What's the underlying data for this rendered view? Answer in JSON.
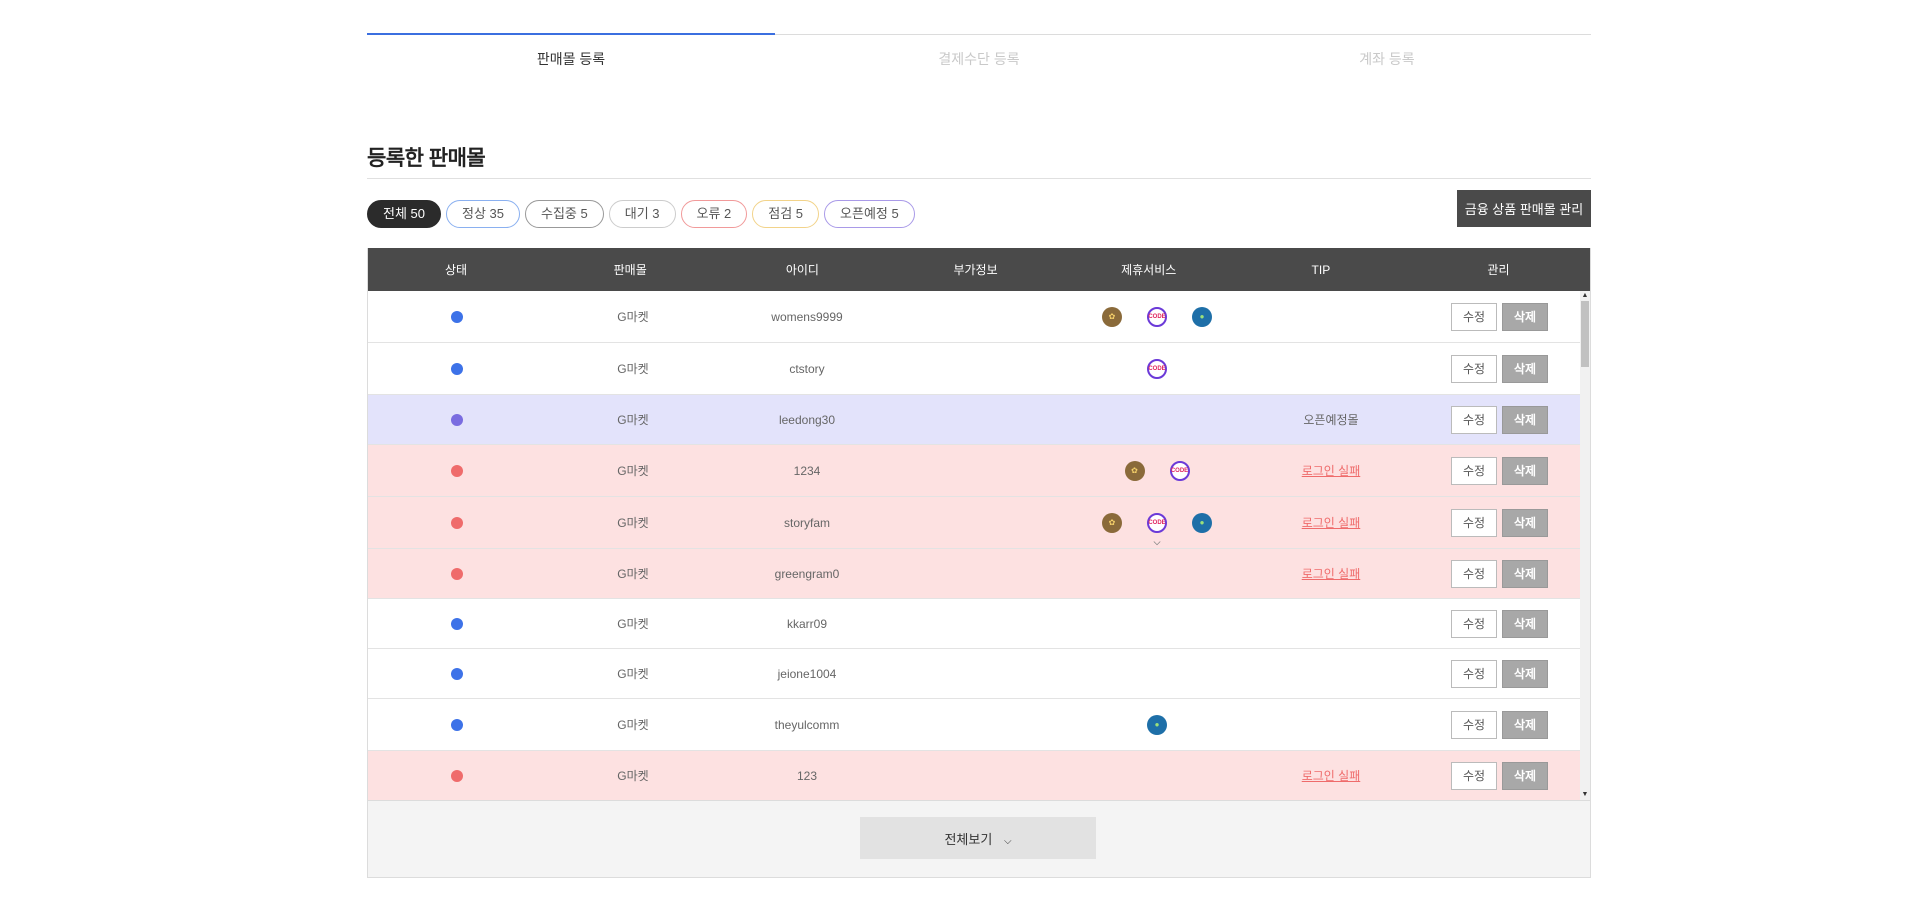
{
  "steps": [
    {
      "label": "판매몰 등록",
      "active": true
    },
    {
      "label": "결제수단 등록",
      "active": false
    },
    {
      "label": "계좌 등록",
      "active": false
    }
  ],
  "section_title": "등록한 판매몰",
  "filters": [
    {
      "label": "전체 50",
      "color": "#2b2b2b",
      "active": true
    },
    {
      "label": "정상 35",
      "color": "#8ab0f0",
      "active": false
    },
    {
      "label": "수집중 5",
      "color": "#999999",
      "active": false
    },
    {
      "label": "대기 3",
      "color": "#cccccc",
      "active": false
    },
    {
      "label": "오류 2",
      "color": "#f19a9a",
      "active": false
    },
    {
      "label": "점검 5",
      "color": "#f2d38a",
      "active": false
    },
    {
      "label": "오픈예정 5",
      "color": "#a99ae8",
      "active": false
    }
  ],
  "manage_button": "금융 상품 판매몰 관리",
  "table": {
    "headers": [
      "상태",
      "판매몰",
      "아이디",
      "부가정보",
      "제휴서비스",
      "TIP",
      "관리"
    ],
    "edit_label": "수정",
    "delete_label": "삭제",
    "rows": [
      {
        "status": "normal",
        "mall": "G마켓",
        "id": "womens9999",
        "extra": "",
        "services": [
          "coin",
          "code",
          "globe"
        ],
        "tip": "",
        "tip_link": false
      },
      {
        "status": "normal",
        "mall": "G마켓",
        "id": "ctstory",
        "extra": "",
        "services": [
          "code"
        ],
        "tip": "",
        "tip_link": false
      },
      {
        "status": "open",
        "mall": "G마켓",
        "id": "leedong30",
        "extra": "",
        "services": [],
        "tip": "오픈예정몰",
        "tip_link": false
      },
      {
        "status": "error",
        "mall": "G마켓",
        "id": "1234",
        "extra": "",
        "services": [
          "coin",
          "code"
        ],
        "tip": "로그인 실패",
        "tip_link": true
      },
      {
        "status": "error",
        "mall": "G마켓",
        "id": "storyfam",
        "extra": "",
        "services": [
          "coin",
          "code",
          "globe"
        ],
        "tip": "로그인 실패",
        "tip_link": true,
        "expand": true
      },
      {
        "status": "error",
        "mall": "G마켓",
        "id": "greengram0",
        "extra": "",
        "services": [],
        "tip": "로그인 실패",
        "tip_link": true
      },
      {
        "status": "normal",
        "mall": "G마켓",
        "id": "kkarr09",
        "extra": "",
        "services": [],
        "tip": "",
        "tip_link": false
      },
      {
        "status": "normal",
        "mall": "G마켓",
        "id": "jeione1004",
        "extra": "",
        "services": [],
        "tip": "",
        "tip_link": false
      },
      {
        "status": "normal",
        "mall": "G마켓",
        "id": "theyulcomm",
        "extra": "",
        "services": [
          "globe"
        ],
        "tip": "",
        "tip_link": false
      },
      {
        "status": "error",
        "mall": "G마켓",
        "id": "123",
        "extra": "",
        "services": [],
        "tip": "로그인 실패",
        "tip_link": true
      }
    ]
  },
  "status_colors": {
    "normal": "#3d72e8",
    "open": "#7a6ce0",
    "error": "#ef6b6b"
  },
  "view_all": "전체보기"
}
